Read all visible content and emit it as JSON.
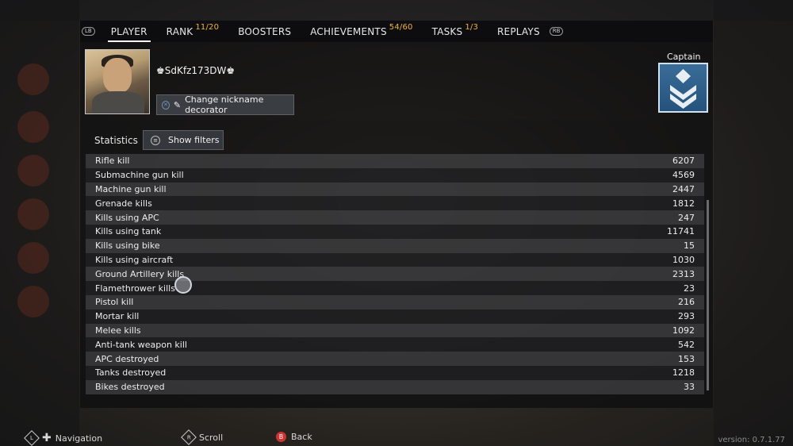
{
  "tabs": {
    "lb": "LB",
    "rb": "RB",
    "items": [
      {
        "label": "PLAYER",
        "badge": ""
      },
      {
        "label": "RANK",
        "badge": "11/20"
      },
      {
        "label": "BOOSTERS",
        "badge": ""
      },
      {
        "label": "ACHIEVEMENTS",
        "badge": "54/60"
      },
      {
        "label": "TASKS",
        "badge": "1/3"
      },
      {
        "label": "REPLAYS",
        "badge": ""
      }
    ]
  },
  "profile": {
    "nickname": "♚SdKfz173DW♚",
    "decorator_button": "Change nickname decorator",
    "rank_title": "Captain"
  },
  "stats": {
    "label": "Statistics",
    "filters_button": "Show filters",
    "rows": [
      {
        "name": "Rifle kill",
        "value": "6207"
      },
      {
        "name": "Submachine gun kill",
        "value": "4569"
      },
      {
        "name": "Machine gun kill",
        "value": "2447"
      },
      {
        "name": "Grenade kills",
        "value": "1812"
      },
      {
        "name": "Kills using APC",
        "value": "247"
      },
      {
        "name": "Kills using tank",
        "value": "11741"
      },
      {
        "name": "Kills using bike",
        "value": "15"
      },
      {
        "name": "Kills using aircraft",
        "value": "1030"
      },
      {
        "name": "Ground Artillery kills",
        "value": "2313"
      },
      {
        "name": "Flamethrower kills",
        "value": "23"
      },
      {
        "name": "Pistol kill",
        "value": "216"
      },
      {
        "name": "Mortar kill",
        "value": "293"
      },
      {
        "name": "Melee kills",
        "value": "1092"
      },
      {
        "name": "Anti-tank weapon kill",
        "value": "542"
      },
      {
        "name": "APC destroyed",
        "value": "153"
      },
      {
        "name": "Tanks destroyed",
        "value": "1218"
      },
      {
        "name": "Bikes destroyed",
        "value": "33"
      }
    ]
  },
  "footer": {
    "navigation": "Navigation",
    "scroll": "Scroll",
    "back": "Back",
    "version": "version: 0.7.1.77"
  },
  "colors": {
    "badge": "#f2b33a",
    "rank_badge": "#2f5f8c"
  }
}
